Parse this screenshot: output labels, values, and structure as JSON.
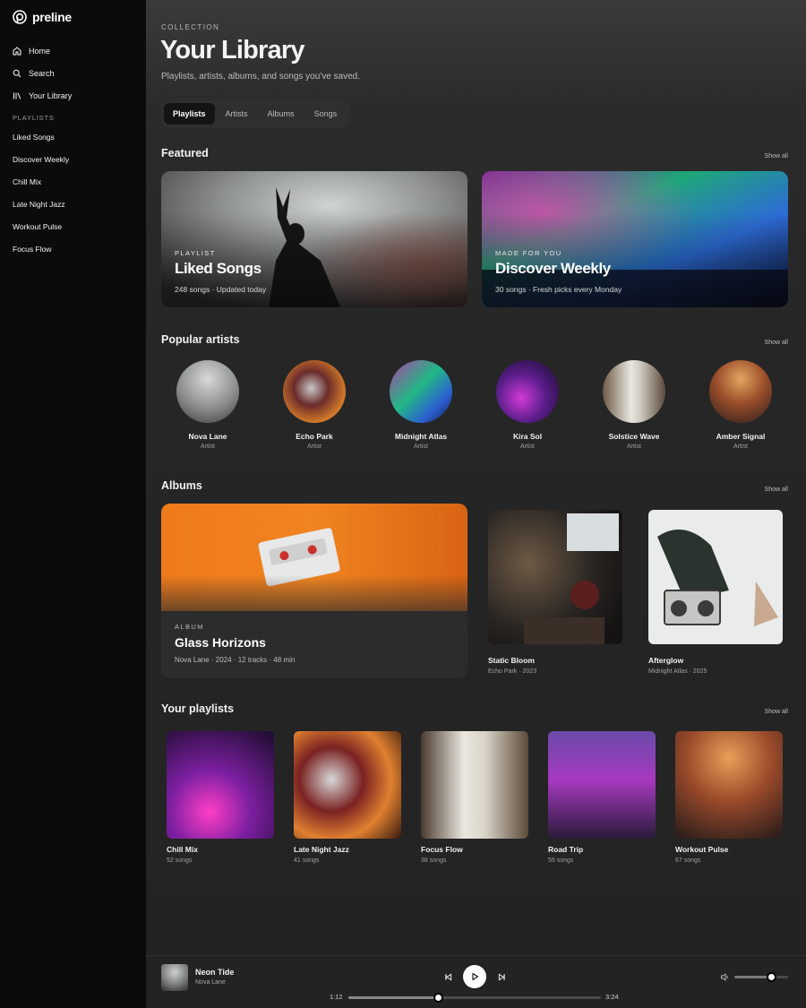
{
  "brand": {
    "name": "preline"
  },
  "sidebar": {
    "nav": [
      {
        "label": "Home",
        "icon": "home-icon"
      },
      {
        "label": "Search",
        "icon": "search-icon"
      },
      {
        "label": "Your Library",
        "icon": "library-icon"
      }
    ],
    "playlists_heading": "PLAYLISTS",
    "playlists": [
      "Liked Songs",
      "Discover Weekly",
      "Chill Mix",
      "Late Night Jazz",
      "Workout Pulse",
      "Focus Flow"
    ]
  },
  "header": {
    "eyebrow": "COLLECTION",
    "title": "Your Library",
    "subtitle": "Playlists, artists, albums, and songs you've saved."
  },
  "tabs": [
    "Playlists",
    "Artists",
    "Albums",
    "Songs"
  ],
  "active_tab": "Playlists",
  "featured": {
    "title": "Featured",
    "show_all": "Show all",
    "cards": [
      {
        "eyebrow": "PLAYLIST",
        "title": "Liked Songs",
        "subtitle": "248 songs · Updated today"
      },
      {
        "eyebrow": "MADE FOR YOU",
        "title": "Discover Weekly",
        "subtitle": "30 songs · Fresh picks every Monday"
      }
    ]
  },
  "artists": {
    "title": "Popular artists",
    "show_all": "Show all",
    "items": [
      {
        "name": "Nova Lane",
        "role": "Artist"
      },
      {
        "name": "Echo Park",
        "role": "Artist"
      },
      {
        "name": "Midnight Atlas",
        "role": "Artist"
      },
      {
        "name": "Kira Sol",
        "role": "Artist"
      },
      {
        "name": "Solstice Wave",
        "role": "Artist"
      },
      {
        "name": "Amber Signal",
        "role": "Artist"
      }
    ]
  },
  "albums": {
    "title": "Albums",
    "show_all": "Show all",
    "highlight": {
      "eyebrow": "ALBUM",
      "title": "Glass Horizons",
      "subtitle": "Nova Lane · 2024 · 12 tracks · 48 min"
    },
    "items": [
      {
        "title": "Static Bloom",
        "subtitle": "Echo Park · 2023"
      },
      {
        "title": "Afterglow",
        "subtitle": "Midnight Atlas · 2025"
      }
    ]
  },
  "playlists": {
    "title": "Your playlists",
    "show_all": "Show all",
    "items": [
      {
        "title": "Chill Mix",
        "subtitle": "52 songs"
      },
      {
        "title": "Late Night Jazz",
        "subtitle": "41 songs"
      },
      {
        "title": "Focus Flow",
        "subtitle": "38 songs"
      },
      {
        "title": "Road Trip",
        "subtitle": "55 songs"
      },
      {
        "title": "Workout Pulse",
        "subtitle": "67 songs"
      }
    ]
  },
  "player": {
    "track": "Neon Tide",
    "artist": "Nova Lane",
    "elapsed": "1:12",
    "duration": "3:24",
    "progress": 0.353,
    "volume": 0.68
  }
}
